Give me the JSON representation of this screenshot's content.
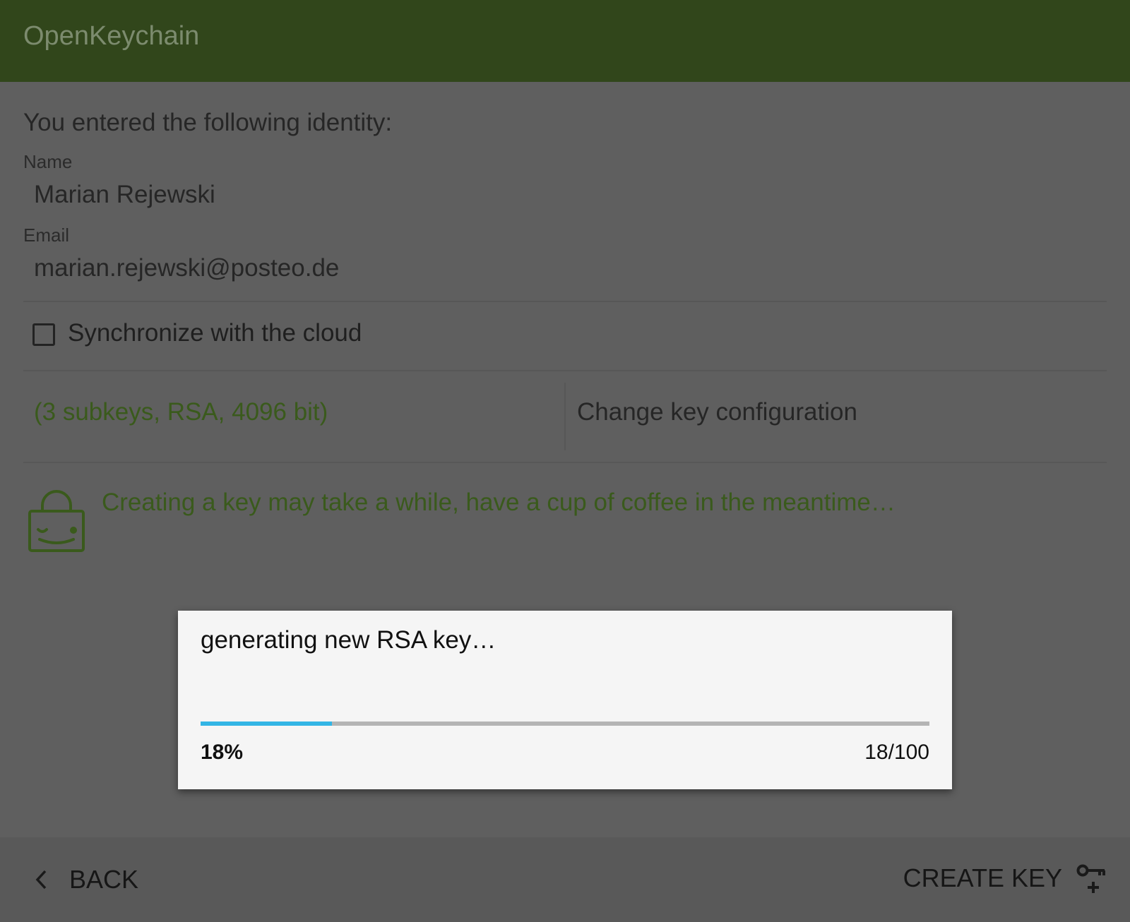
{
  "app": {
    "title": "OpenKeychain",
    "accent_color": "#31461b"
  },
  "identity": {
    "intro": "You entered the following identity:",
    "name_label": "Name",
    "name_value": "Marian Rejewski",
    "email_label": "Email",
    "email_value": "marian.rejewski@posteo.de"
  },
  "sync": {
    "label": "Synchronize with the cloud",
    "checked": false
  },
  "key_config": {
    "summary": "(3 subkeys, RSA, 4096 bit)",
    "change_label": "Change key configuration"
  },
  "hint": {
    "icon": "lock-smiley-icon",
    "text": "Creating a key may take a while, have a cup of coffee in the meantime…"
  },
  "bottom_bar": {
    "back_label": "BACK",
    "back_icon": "chevron-left-icon",
    "create_label": "CREATE KEY",
    "create_icon": "key-plus-icon"
  },
  "dialog": {
    "message": "generating new RSA key…",
    "progress_fraction": 0.18,
    "progress_color": "#33b5e5",
    "percent_text": "18%",
    "count_text": "18/100"
  }
}
